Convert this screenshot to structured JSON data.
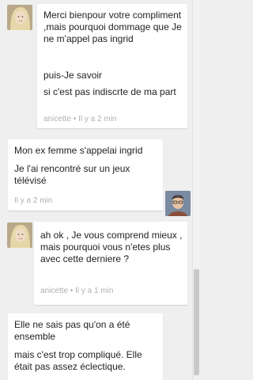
{
  "conversation": {
    "messages": [
      {
        "sender": "anicette",
        "lines": [
          "Merci bienpour votre compliment ,mais pourquoi dommage que Je ne m'appel pas ingrid",
          "puis-Je savoir",
          "si c'est pas indiscrte de ma part"
        ],
        "timestamp": "anicette • Il y a 2 min"
      },
      {
        "sender": "me",
        "lines": [
          "Mon ex femme s'appelai ingrid",
          "Je l'ai rencontré sur un jeux télévisé"
        ],
        "timestamp": "Il y a 2 min"
      },
      {
        "sender": "anicette",
        "lines": [
          "ah ok , Je vous comprend mieux , mais pourquoi vous n'etes plus avec cette derniere ?"
        ],
        "timestamp": "anicette • Il y a 1 min"
      },
      {
        "sender": "me",
        "lines": [
          "Elle ne sais pas qu'on a été ensemble",
          "mais c'est trop compliqué. Elle était pas assez éclectique."
        ],
        "timestamp": ""
      }
    ]
  }
}
